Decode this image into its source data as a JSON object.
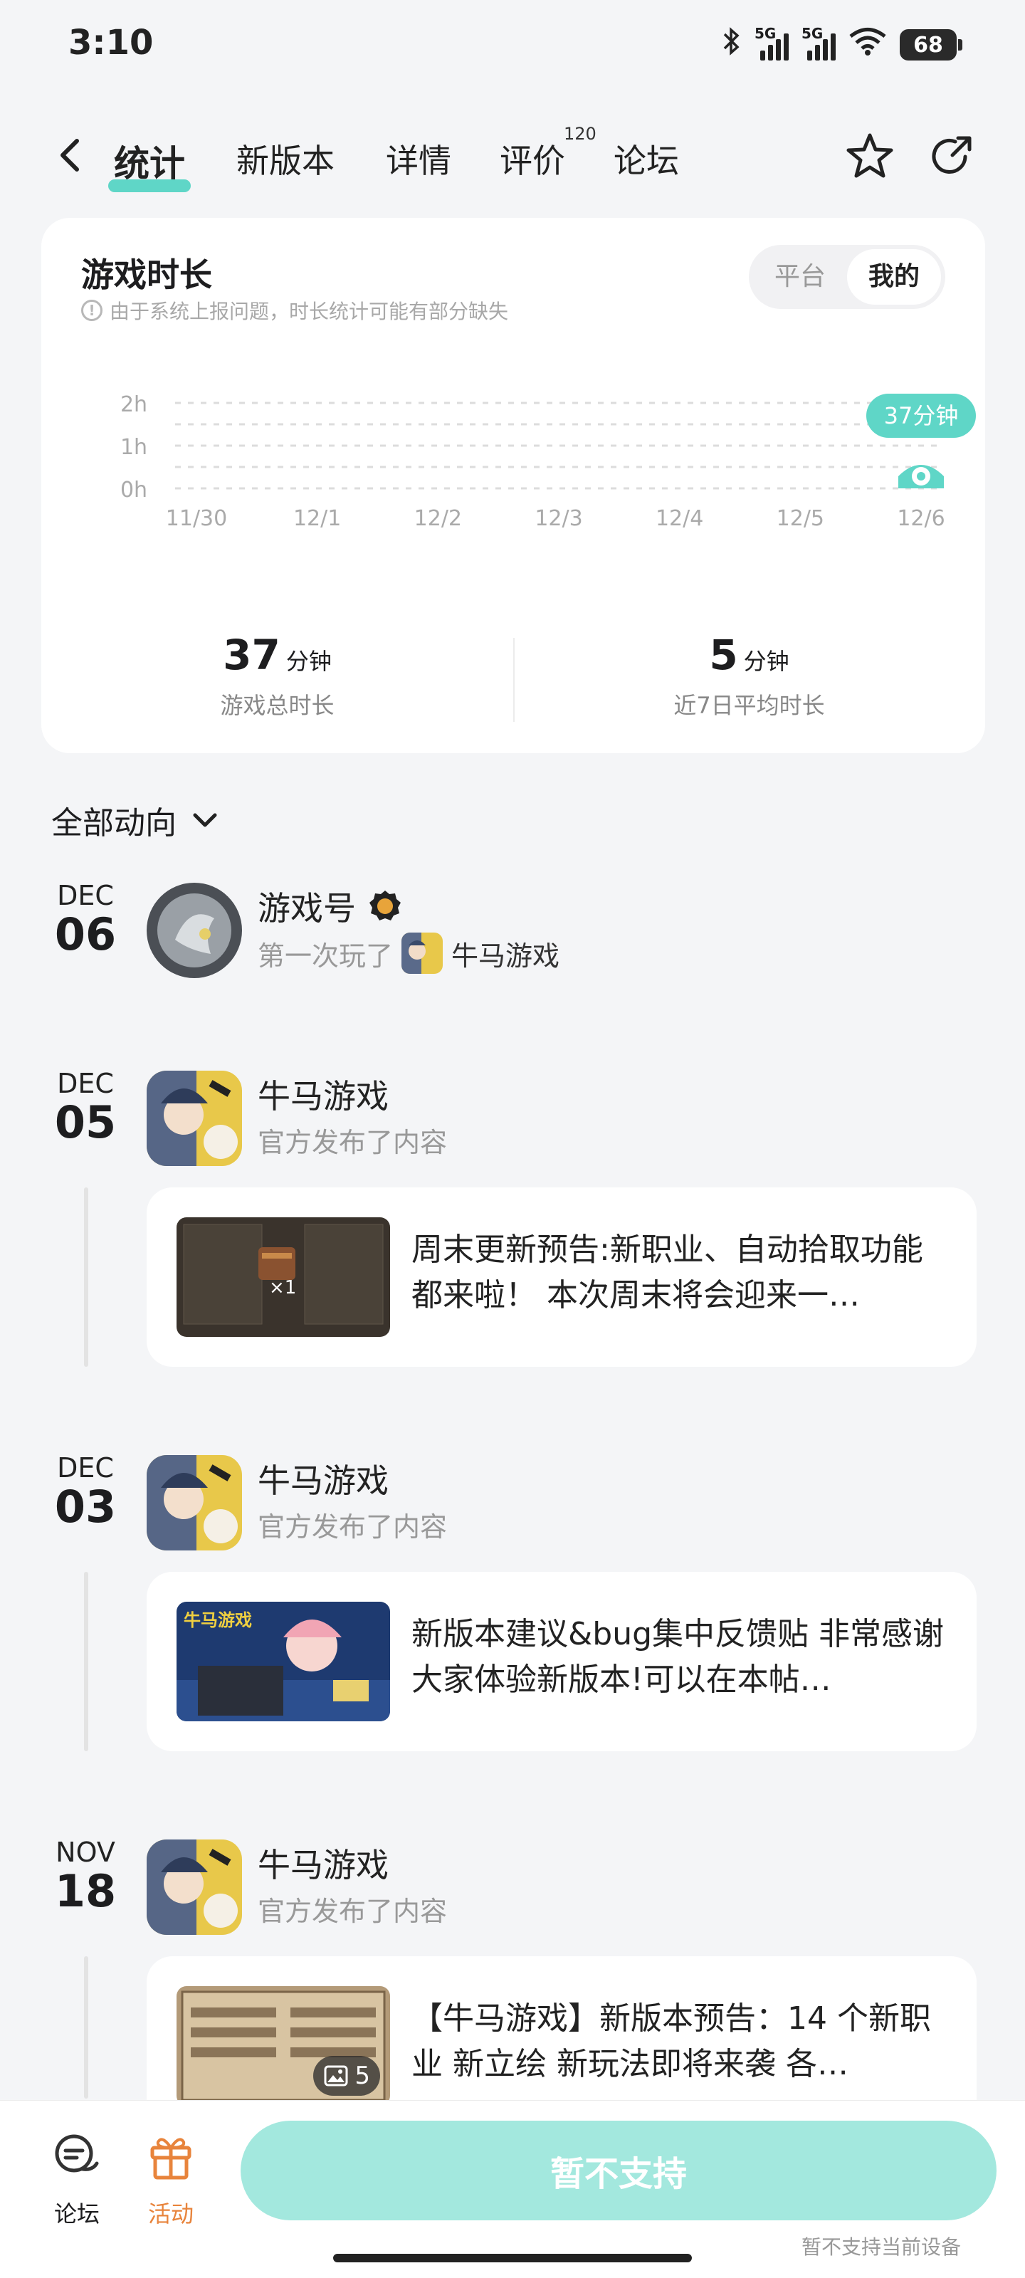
{
  "status": {
    "time": "3:10",
    "net1": "5G",
    "net2": "5G",
    "battery": "68"
  },
  "nav": {
    "tabs": [
      {
        "label": "统计"
      },
      {
        "label": "新版本"
      },
      {
        "label": "详情"
      },
      {
        "label": "评价",
        "badge": "120"
      },
      {
        "label": "论坛"
      }
    ]
  },
  "stats": {
    "title": "游戏时长",
    "note": "由于系统上报问题，时长统计可能有部分缺失",
    "toggle": [
      "平台",
      "我的"
    ],
    "total_value": "37",
    "total_unit": "分钟",
    "total_caption": "游戏总时长",
    "avg_value": "5",
    "avg_unit": "分钟",
    "avg_caption": "近7日平均时长"
  },
  "chart_data": {
    "type": "bar",
    "categories": [
      "11/30",
      "12/1",
      "12/2",
      "12/3",
      "12/4",
      "12/5",
      "12/6"
    ],
    "values": [
      0,
      0,
      0,
      0,
      0,
      0,
      37
    ],
    "y_ticks": [
      "0h",
      "1h",
      "2h"
    ],
    "ylim": [
      0,
      120
    ],
    "callout": "37分钟",
    "grid": true,
    "accent": "#5fd6c7"
  },
  "filter": {
    "label": "全部动向"
  },
  "timeline": [
    {
      "month": "DEC",
      "day": "06",
      "name": "游戏号",
      "sub_prefix": "第一次玩了",
      "sub_game": "牛马游戏"
    },
    {
      "month": "DEC",
      "day": "05",
      "name": "牛马游戏",
      "sub": "官方发布了内容",
      "post_text": "周末更新预告:新职业、自动拾取功能都来啦！ 本次周末将会迎来一…",
      "thumb_text": "×1"
    },
    {
      "month": "DEC",
      "day": "03",
      "name": "牛马游戏",
      "sub": "官方发布了内容",
      "post_text": "新版本建议&bug集中反馈贴 非常感谢大家体验新版本!可以在本帖…",
      "thumb_text": "牛马游戏"
    },
    {
      "month": "NOV",
      "day": "18",
      "name": "牛马游戏",
      "sub": "官方发布了内容",
      "post_text": "【牛马游戏】新版本预告：14 个新职业 新立绘 新玩法即将来袭 各…",
      "img_count": "5"
    }
  ],
  "bottom": {
    "forum": "论坛",
    "activity": "活动",
    "cta": "暂不支持",
    "cta_note": "暂不支持当前设备",
    "accent": "#e8843c"
  }
}
